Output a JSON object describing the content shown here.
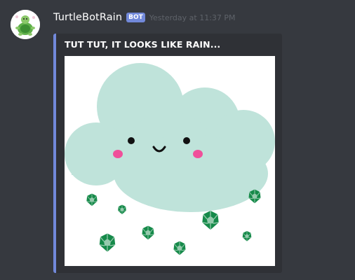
{
  "message": {
    "username": "TurtleBotRain",
    "bot_tag": "BOT",
    "timestamp": "Yesterday at 11:37 PM",
    "embed": {
      "title": "TUT TUT, IT LOOKS LIKE RAIN...",
      "accent_color": "#7289da"
    }
  },
  "colors": {
    "background": "#36393f",
    "embed_background": "#2f3136",
    "cloud": "#bfe3da",
    "cheek": "#f0509a",
    "turtle_shell": "#168a4a"
  }
}
